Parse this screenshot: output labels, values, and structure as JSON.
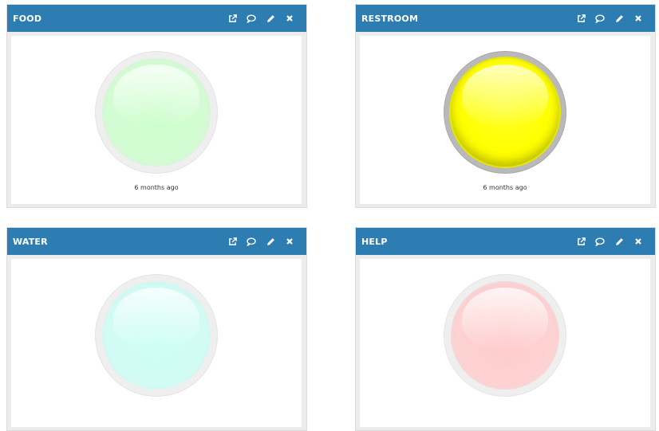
{
  "widgets": [
    {
      "title": "FOOD",
      "status": "6 months ago",
      "lamp_color": "#ccffcc",
      "lamp_state": "off",
      "tools": [
        "external-link-icon",
        "comment-icon",
        "pencil-icon",
        "close-icon"
      ]
    },
    {
      "title": "RESTROOM",
      "status": "6 months ago",
      "lamp_color": "#ffff00",
      "lamp_state": "on",
      "tools": [
        "external-link-icon",
        "comment-icon",
        "pencil-icon",
        "close-icon"
      ]
    },
    {
      "title": "WATER",
      "status": "",
      "lamp_color": "#ccfff6",
      "lamp_state": "off",
      "tools": [
        "external-link-icon",
        "comment-icon",
        "pencil-icon",
        "close-icon"
      ]
    },
    {
      "title": "HELP",
      "status": "",
      "lamp_color": "#ffcccc",
      "lamp_state": "off",
      "tools": [
        "external-link-icon",
        "comment-icon",
        "pencil-icon",
        "close-icon"
      ]
    }
  ],
  "theme": {
    "header_color": "#2e7db2",
    "panel_border": "#ececec"
  }
}
